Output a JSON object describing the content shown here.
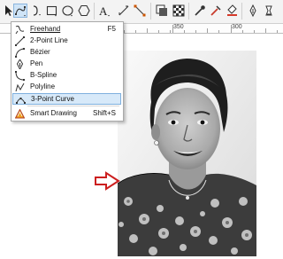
{
  "ruler": {
    "marks": [
      "350",
      "300"
    ]
  },
  "menu": {
    "items": [
      {
        "label": "Freehand",
        "shortcut": "F5",
        "icon": "freehand-icon"
      },
      {
        "label": "2-Point Line",
        "shortcut": "",
        "icon": "two-point-line-icon"
      },
      {
        "label": "Bézier",
        "shortcut": "",
        "icon": "bezier-icon"
      },
      {
        "label": "Pen",
        "shortcut": "",
        "icon": "pen-icon"
      },
      {
        "label": "B-Spline",
        "shortcut": "",
        "icon": "b-spline-icon"
      },
      {
        "label": "Polyline",
        "shortcut": "",
        "icon": "polyline-icon"
      },
      {
        "label": "3-Point Curve",
        "shortcut": "",
        "icon": "three-point-curve-icon",
        "selected": true
      },
      {
        "label": "Smart Drawing",
        "shortcut": "Shift+S",
        "icon": "smart-drawing-icon"
      }
    ]
  },
  "colors": {
    "arrow": "#cc1f1f",
    "selection": "#d7e9f9",
    "toolbar": "#f3f3f3"
  }
}
